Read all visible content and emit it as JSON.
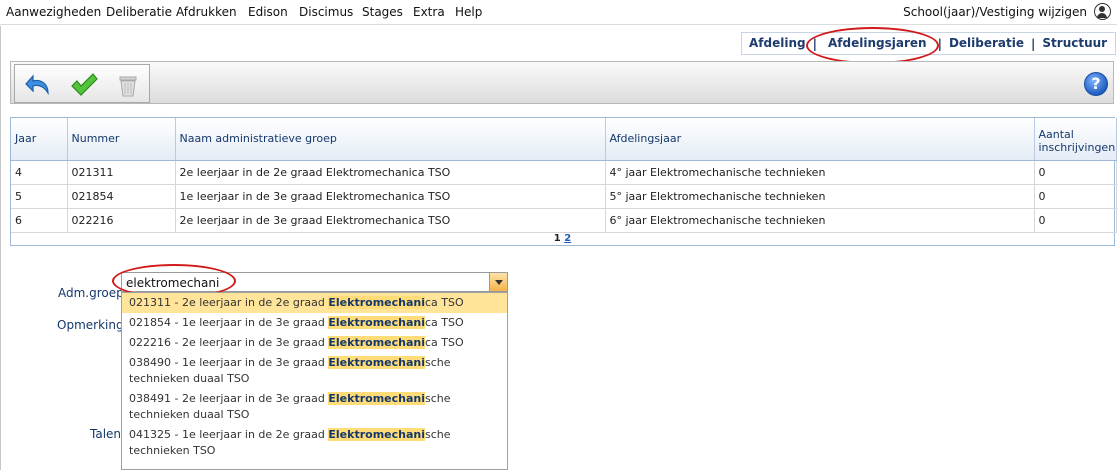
{
  "menu": {
    "items": [
      "Aanwezigheden",
      "Deliberatie",
      "Afdrukken",
      "Edison",
      "Discimus",
      "Stages",
      "Extra",
      "Help"
    ],
    "right_label": "School(jaar)/Vestiging wijzigen",
    "user_icon": "user-circle-icon"
  },
  "tabs": {
    "items": [
      {
        "label": "Afdeling",
        "active": false
      },
      {
        "label": "Afdelingsjaren",
        "active": true
      },
      {
        "label": "Deliberatie",
        "active": false
      },
      {
        "label": "Structuur",
        "active": false
      }
    ],
    "separator": "|"
  },
  "toolbar": {
    "undo_icon": "undo-arrow-icon",
    "save_icon": "checkmark-icon",
    "delete_icon": "trash-bin-icon",
    "help_label": "?"
  },
  "table": {
    "columns": [
      "Jaar",
      "Nummer",
      "Naam administratieve groep",
      "Afdelingsjaar",
      "Aantal inschrijvingen"
    ],
    "rows": [
      [
        "4",
        "021311",
        "2e leerjaar in de 2e graad Elektromechanica TSO",
        "4° jaar Elektromechanische technieken",
        "0"
      ],
      [
        "5",
        "021854",
        "1e leerjaar in de 3e graad Elektromechanica TSO",
        "5° jaar Elektromechanische technieken",
        "0"
      ],
      [
        "6",
        "022216",
        "2e leerjaar in de 3e graad Elektromechanica TSO",
        "6° jaar Elektromechanische technieken",
        "0"
      ]
    ],
    "pager": {
      "current": "1",
      "next": "2"
    }
  },
  "form": {
    "adm_groep_label": "Adm.groep",
    "opmerking_label": "Opmerking",
    "talen_label": "Talen",
    "adm_groep_value": "elektromechani"
  },
  "dropdown": {
    "options": [
      {
        "pre": "021311 - 2e leerjaar in de 2e graad ",
        "match": "Elektromechani",
        "post": "ca TSO",
        "selected": true
      },
      {
        "pre": "021854 - 1e leerjaar in de 3e graad ",
        "match": "Elektromechani",
        "post": "ca TSO",
        "selected": false
      },
      {
        "pre": "022216 - 2e leerjaar in de 3e graad ",
        "match": "Elektromechani",
        "post": "ca TSO",
        "selected": false
      },
      {
        "pre": "038490 - 1e leerjaar in de 3e graad ",
        "match": "Elektromechani",
        "post": "sche technieken duaal TSO",
        "selected": false
      },
      {
        "pre": "038491 - 2e leerjaar in de 3e graad ",
        "match": "Elektromechani",
        "post": "sche technieken duaal TSO",
        "selected": false
      },
      {
        "pre": "041325 - 1e leerjaar in de 2e graad ",
        "match": "Elektromechani",
        "post": "sche technieken TSO",
        "selected": false
      }
    ]
  },
  "colors": {
    "accent": "#3c6fa8",
    "annotation_red": "#d21a1a",
    "highlight": "#ffdc78"
  }
}
